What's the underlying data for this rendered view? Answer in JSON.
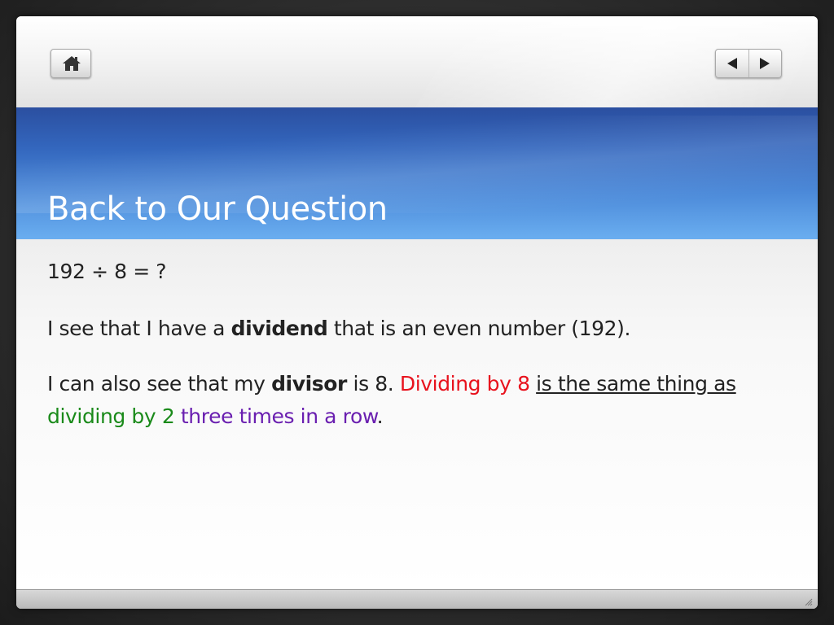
{
  "nav": {
    "home_icon": "home-icon",
    "prev_icon": "triangle-left-icon",
    "next_icon": "triangle-right-icon"
  },
  "slide": {
    "title": "Back to Our Question",
    "paragraph1": "192 ÷ 8 = ?",
    "paragraph2": {
      "before": "I see that I have a ",
      "bold": "dividend",
      "after": " that is an even number (192)."
    },
    "paragraph3": {
      "before": "I can also see that my ",
      "bold": "divisor",
      "after_bold": " is 8. ",
      "red": "Dividing by 8",
      "space1": " ",
      "underlined": "is the same thing as",
      "space2": " ",
      "green": "dividing by 2",
      "space3": " ",
      "purple": "three times in a row",
      "end": "."
    }
  },
  "colors": {
    "title_band": "#3366bd",
    "highlight_red": "#e8121d",
    "highlight_green": "#1a8a1a",
    "highlight_purple": "#6a1fb0"
  }
}
